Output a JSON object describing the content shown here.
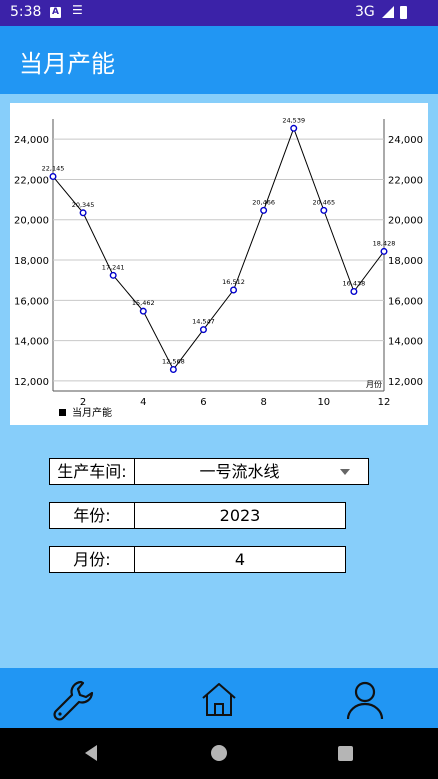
{
  "status_bar": {
    "time": "5:38",
    "network": "3G",
    "icons": [
      "notification-a-icon",
      "sim-icon",
      "signal-icon",
      "battery-icon"
    ]
  },
  "app_bar": {
    "title": "当月产能"
  },
  "chart_data": {
    "type": "line",
    "x": [
      1,
      2,
      3,
      4,
      5,
      6,
      7,
      8,
      9,
      10,
      11,
      12
    ],
    "x_ticks": [
      "2",
      "4",
      "6",
      "8",
      "10",
      "12"
    ],
    "series": [
      {
        "name": "当月产能",
        "values": [
          22145,
          20345,
          17241,
          15462,
          12568,
          14547,
          16512,
          20466,
          24539,
          20465,
          16438,
          18428
        ],
        "labels": [
          "22,145",
          "20,345",
          "17,241",
          "15,462",
          "12,568",
          "14,547",
          "16,512",
          "20,466",
          "24,539",
          "20,465",
          "16,438",
          "18,428"
        ]
      }
    ],
    "y_ticks": [
      "12,000",
      "14,000",
      "16,000",
      "18,000",
      "20,000",
      "22,000",
      "24,000"
    ],
    "xlabel": "月份",
    "ylabel": "",
    "xlim": [
      1,
      12
    ],
    "ylim": [
      11500,
      25000
    ],
    "grid": true,
    "legend": "bottom-left",
    "colors": {
      "line": "#000000",
      "marker": "#0000cc",
      "grid": "#c8c8c8"
    }
  },
  "form": {
    "workshop": {
      "label": "生产车间:",
      "value": "一号流水线"
    },
    "year": {
      "label": "年份:",
      "value": "2023"
    },
    "month": {
      "label": "月份:",
      "value": "4"
    }
  },
  "bottom_nav": {
    "items": [
      "wrench-icon",
      "home-icon",
      "user-icon"
    ]
  },
  "colors": {
    "status_bar": "#3b22a8",
    "app_bar": "#2196f3",
    "background": "#87cefa"
  }
}
